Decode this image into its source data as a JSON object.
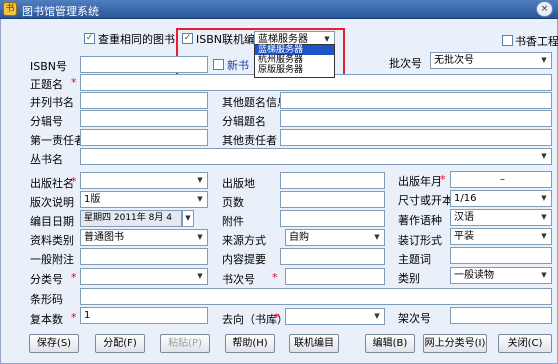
{
  "window": {
    "title": "图书馆管理系统",
    "close_glyph": "×"
  },
  "top": {
    "check_dup_label": "查重相同的图书",
    "isbn_online_label": "ISBN联机编目",
    "server_selected": "蓝梯服务器",
    "server_options": [
      "蓝梯服务器",
      "杭州服务器",
      "原版服务器"
    ],
    "book_project_label": "书香工程",
    "new_book_label": "新书",
    "batch_label": "批次号",
    "batch_value": "无批次号"
  },
  "labels": {
    "isbn": "ISBN号",
    "main_title": "正题名",
    "parallel_title": "并列书名",
    "other_title_info": "其他题名信息",
    "section_no": "分辑号",
    "section_title": "分辑题名",
    "first_responsible": "第一责任者",
    "other_responsible": "其他责任者",
    "series_title": "丛书名",
    "publisher": "出版社名",
    "pub_place": "出版地",
    "pub_date": "出版年月",
    "edition_note": "版次说明",
    "pages": "页数",
    "size": "尺寸或开本",
    "catalog_date": "编目日期",
    "attachment": "附件",
    "language": "著作语种",
    "material_type": "资料类别",
    "source_method": "来源方式",
    "binding": "装订形式",
    "general_note": "一般附注",
    "content_summary": "内容提要",
    "subject": "主题词",
    "class_no": "分类号",
    "author_no": "书次号",
    "category": "类别",
    "barcode": "条形码",
    "copies": "复本数",
    "location": "去向（书库）",
    "shelf_no": "架次号",
    "star": "*"
  },
  "values": {
    "pub_date": "–",
    "edition": "1版",
    "size": "1/16",
    "catalog_date": "星期四 2011年 8月 4",
    "language": "汉语",
    "material_type": "普通图书",
    "source_method": "自购",
    "binding": "平装",
    "category": "一般读物",
    "copies": "1"
  },
  "buttons": {
    "save": "保存(S)",
    "split": "分配(F)",
    "paste": "粘贴(P)",
    "help": "帮助(H)",
    "online_catalog": "联机编目",
    "edit": "编辑(B)",
    "online_class": "网上分类号(I)",
    "close": "关闭(C)"
  }
}
